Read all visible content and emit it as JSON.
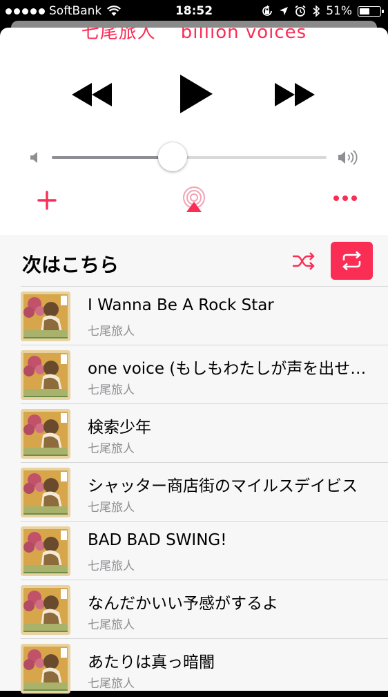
{
  "status_bar": {
    "carrier": "SoftBank",
    "time": "18:52",
    "battery": "51%",
    "battery_level": 0.51
  },
  "now_playing": {
    "title_fragment_left": "七尾旅人",
    "title_fragment_right": "billion voices"
  },
  "volume": {
    "level": 0.44
  },
  "up_next": {
    "title": "次はこちら",
    "accent_color": "#fa2d55",
    "tracks": [
      {
        "title": "I Wanna Be A Rock Star",
        "artist": "七尾旅人"
      },
      {
        "title": "one voice (もしもわたしが声を出せたら)",
        "artist": "七尾旅人"
      },
      {
        "title": "検索少年",
        "artist": "七尾旅人"
      },
      {
        "title": "シャッター商店街のマイルスデイビス",
        "artist": "七尾旅人"
      },
      {
        "title": "BAD BAD SWING!",
        "artist": "七尾旅人"
      },
      {
        "title": "なんだかいい予感がするよ",
        "artist": "七尾旅人"
      },
      {
        "title": "あたりは真っ暗闇",
        "artist": "七尾旅人"
      }
    ]
  }
}
